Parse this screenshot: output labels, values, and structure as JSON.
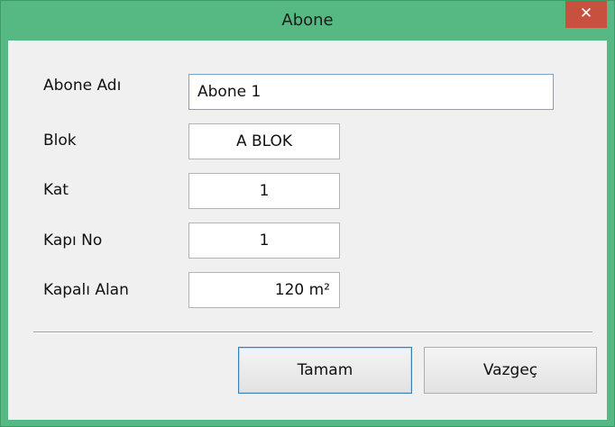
{
  "window": {
    "title": "Abone",
    "close_glyph": "✕"
  },
  "form": {
    "fields": [
      {
        "label": "Abone Adı",
        "value": "Abone 1"
      },
      {
        "label": "Blok",
        "value": "A BLOK"
      },
      {
        "label": "Kat",
        "value": "1"
      },
      {
        "label": "Kapı No",
        "value": "1"
      },
      {
        "label": "Kapalı Alan",
        "value": "120 m²"
      }
    ]
  },
  "buttons": {
    "ok_label": "Tamam",
    "cancel_label": "Vazgeç"
  },
  "colors": {
    "titlebar": "#56b984",
    "close_button": "#c7503f",
    "dialog_background": "#f0f0f0",
    "focus_border": "#6ea6dc",
    "default_button_border": "#3c7fb1"
  },
  "icons": {
    "close": "close-icon"
  }
}
